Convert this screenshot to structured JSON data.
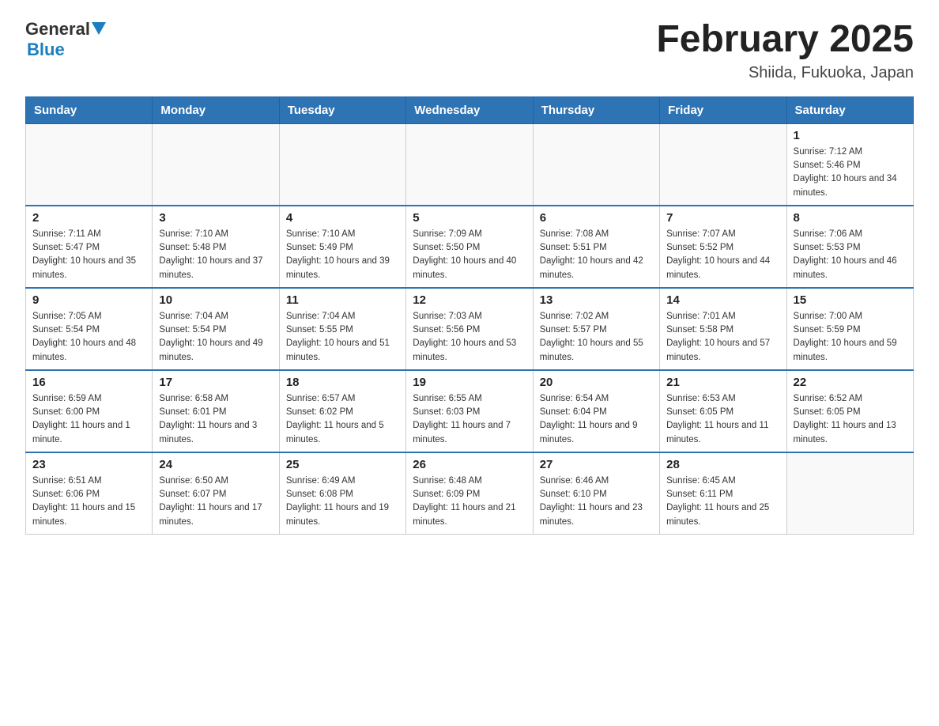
{
  "header": {
    "logo_general": "General",
    "logo_blue": "Blue",
    "month_title": "February 2025",
    "location": "Shiida, Fukuoka, Japan"
  },
  "days_of_week": [
    "Sunday",
    "Monday",
    "Tuesday",
    "Wednesday",
    "Thursday",
    "Friday",
    "Saturday"
  ],
  "weeks": [
    [
      {
        "day": "",
        "info": ""
      },
      {
        "day": "",
        "info": ""
      },
      {
        "day": "",
        "info": ""
      },
      {
        "day": "",
        "info": ""
      },
      {
        "day": "",
        "info": ""
      },
      {
        "day": "",
        "info": ""
      },
      {
        "day": "1",
        "info": "Sunrise: 7:12 AM\nSunset: 5:46 PM\nDaylight: 10 hours and 34 minutes."
      }
    ],
    [
      {
        "day": "2",
        "info": "Sunrise: 7:11 AM\nSunset: 5:47 PM\nDaylight: 10 hours and 35 minutes."
      },
      {
        "day": "3",
        "info": "Sunrise: 7:10 AM\nSunset: 5:48 PM\nDaylight: 10 hours and 37 minutes."
      },
      {
        "day": "4",
        "info": "Sunrise: 7:10 AM\nSunset: 5:49 PM\nDaylight: 10 hours and 39 minutes."
      },
      {
        "day": "5",
        "info": "Sunrise: 7:09 AM\nSunset: 5:50 PM\nDaylight: 10 hours and 40 minutes."
      },
      {
        "day": "6",
        "info": "Sunrise: 7:08 AM\nSunset: 5:51 PM\nDaylight: 10 hours and 42 minutes."
      },
      {
        "day": "7",
        "info": "Sunrise: 7:07 AM\nSunset: 5:52 PM\nDaylight: 10 hours and 44 minutes."
      },
      {
        "day": "8",
        "info": "Sunrise: 7:06 AM\nSunset: 5:53 PM\nDaylight: 10 hours and 46 minutes."
      }
    ],
    [
      {
        "day": "9",
        "info": "Sunrise: 7:05 AM\nSunset: 5:54 PM\nDaylight: 10 hours and 48 minutes."
      },
      {
        "day": "10",
        "info": "Sunrise: 7:04 AM\nSunset: 5:54 PM\nDaylight: 10 hours and 49 minutes."
      },
      {
        "day": "11",
        "info": "Sunrise: 7:04 AM\nSunset: 5:55 PM\nDaylight: 10 hours and 51 minutes."
      },
      {
        "day": "12",
        "info": "Sunrise: 7:03 AM\nSunset: 5:56 PM\nDaylight: 10 hours and 53 minutes."
      },
      {
        "day": "13",
        "info": "Sunrise: 7:02 AM\nSunset: 5:57 PM\nDaylight: 10 hours and 55 minutes."
      },
      {
        "day": "14",
        "info": "Sunrise: 7:01 AM\nSunset: 5:58 PM\nDaylight: 10 hours and 57 minutes."
      },
      {
        "day": "15",
        "info": "Sunrise: 7:00 AM\nSunset: 5:59 PM\nDaylight: 10 hours and 59 minutes."
      }
    ],
    [
      {
        "day": "16",
        "info": "Sunrise: 6:59 AM\nSunset: 6:00 PM\nDaylight: 11 hours and 1 minute."
      },
      {
        "day": "17",
        "info": "Sunrise: 6:58 AM\nSunset: 6:01 PM\nDaylight: 11 hours and 3 minutes."
      },
      {
        "day": "18",
        "info": "Sunrise: 6:57 AM\nSunset: 6:02 PM\nDaylight: 11 hours and 5 minutes."
      },
      {
        "day": "19",
        "info": "Sunrise: 6:55 AM\nSunset: 6:03 PM\nDaylight: 11 hours and 7 minutes."
      },
      {
        "day": "20",
        "info": "Sunrise: 6:54 AM\nSunset: 6:04 PM\nDaylight: 11 hours and 9 minutes."
      },
      {
        "day": "21",
        "info": "Sunrise: 6:53 AM\nSunset: 6:05 PM\nDaylight: 11 hours and 11 minutes."
      },
      {
        "day": "22",
        "info": "Sunrise: 6:52 AM\nSunset: 6:05 PM\nDaylight: 11 hours and 13 minutes."
      }
    ],
    [
      {
        "day": "23",
        "info": "Sunrise: 6:51 AM\nSunset: 6:06 PM\nDaylight: 11 hours and 15 minutes."
      },
      {
        "day": "24",
        "info": "Sunrise: 6:50 AM\nSunset: 6:07 PM\nDaylight: 11 hours and 17 minutes."
      },
      {
        "day": "25",
        "info": "Sunrise: 6:49 AM\nSunset: 6:08 PM\nDaylight: 11 hours and 19 minutes."
      },
      {
        "day": "26",
        "info": "Sunrise: 6:48 AM\nSunset: 6:09 PM\nDaylight: 11 hours and 21 minutes."
      },
      {
        "day": "27",
        "info": "Sunrise: 6:46 AM\nSunset: 6:10 PM\nDaylight: 11 hours and 23 minutes."
      },
      {
        "day": "28",
        "info": "Sunrise: 6:45 AM\nSunset: 6:11 PM\nDaylight: 11 hours and 25 minutes."
      },
      {
        "day": "",
        "info": ""
      }
    ]
  ]
}
